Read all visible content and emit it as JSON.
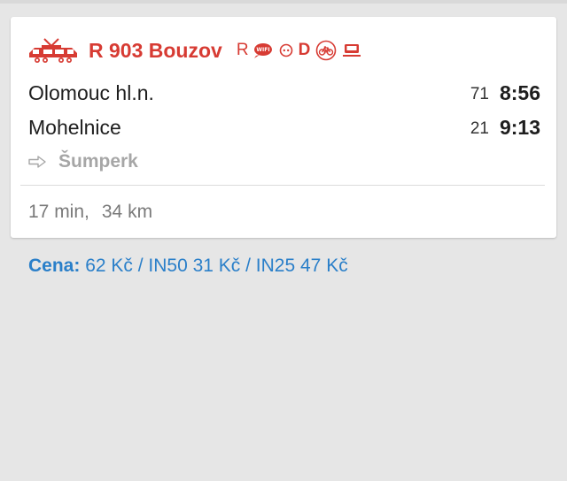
{
  "connection": {
    "train_name": "R 903 Bouzov",
    "amenities": [
      {
        "name": "reserved-seat",
        "label": "R"
      },
      {
        "name": "wifi-icon",
        "label": "WIFI"
      },
      {
        "name": "power-outlet-icon"
      },
      {
        "name": "disabled-access",
        "label": "D"
      },
      {
        "name": "bicycle-icon"
      },
      {
        "name": "sleeper-car-icon"
      }
    ],
    "stops": [
      {
        "name": "Olomouc hl.n.",
        "km": "71",
        "time": "8:56"
      },
      {
        "name": "Mohelnice",
        "km": "21",
        "time": "9:13"
      }
    ],
    "direction": "Šumperk",
    "duration": "17 min,",
    "distance": "34 km"
  },
  "price": {
    "label": "Cena:",
    "value": "62 Kč / IN50 31 Kč / IN25 47 Kč"
  },
  "colors": {
    "accent_red": "#d73b33",
    "link_blue": "#2a7fc9",
    "muted_gray": "#a6a6a6",
    "background": "#e6e6e6"
  }
}
